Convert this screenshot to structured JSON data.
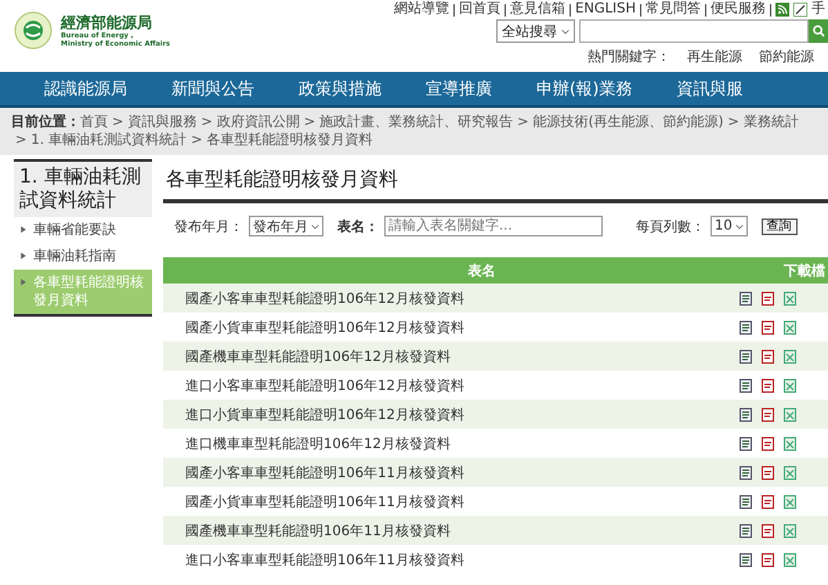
{
  "top_links": [
    "網站導覽",
    "回首頁",
    "意見信箱",
    "ENGLISH",
    "常見問答",
    "便民服務"
  ],
  "top_icon_label": "手",
  "logo": {
    "name": "經濟部能源局",
    "english_1": "Bureau of Energy ,",
    "english_2": "Ministry of Economic Affairs"
  },
  "search": {
    "scope": "全站搜尋"
  },
  "hot_keywords": {
    "label": "熱門關鍵字：",
    "items": [
      "再生能源",
      "節約能源"
    ]
  },
  "nav": [
    "認識能源局",
    "新聞與公告",
    "政策與措施",
    "宣導推廣",
    "申辦(報)業務",
    "資訊與服"
  ],
  "breadcrumb": {
    "label": "目前位置：",
    "separator": ">",
    "items": [
      "首頁",
      "資訊與服務",
      "政府資訊公開",
      "施政計畫、業務統計、研究報告",
      "能源技術(再生能源、節約能源)",
      "業務統計",
      "1. 車輛油耗測試資料統計",
      "各車型耗能證明核發月資料"
    ]
  },
  "sidebar": {
    "title": "1. 車輛油耗測試資料統計",
    "items": [
      {
        "label": "車輛省能要訣",
        "selected": false
      },
      {
        "label": "車輛油耗指南",
        "selected": false
      },
      {
        "label": "各車型耗能證明核發月資料",
        "selected": true
      }
    ]
  },
  "page_title": "各車型耗能證明核發月資料",
  "filters": {
    "month_label": "發布年月：",
    "month_value": "發布年月",
    "name_label": "表名：",
    "name_placeholder": "請輸入表名關鍵字...",
    "per_page_label": "每頁列數：",
    "per_page_value": "10",
    "query_button": "查詢"
  },
  "table": {
    "columns": [
      "表名",
      "下載檔"
    ],
    "rows": [
      "國產小客車車型耗能證明106年12月核發資料",
      "國產小貨車車型耗能證明106年12月核發資料",
      "國產機車車型耗能證明106年12月核發資料",
      "進口小客車車型耗能證明106年12月核發資料",
      "進口小貨車車型耗能證明106年12月核發資料",
      "進口機車車型耗能證明106年12月核發資料",
      "國產小客車車型耗能證明106年11月核發資料",
      "國產小貨車車型耗能證明106年11月核發資料",
      "國產機車車型耗能證明106年11月核發資料",
      "進口小客車車型耗能證明106年11月核發資料"
    ]
  }
}
